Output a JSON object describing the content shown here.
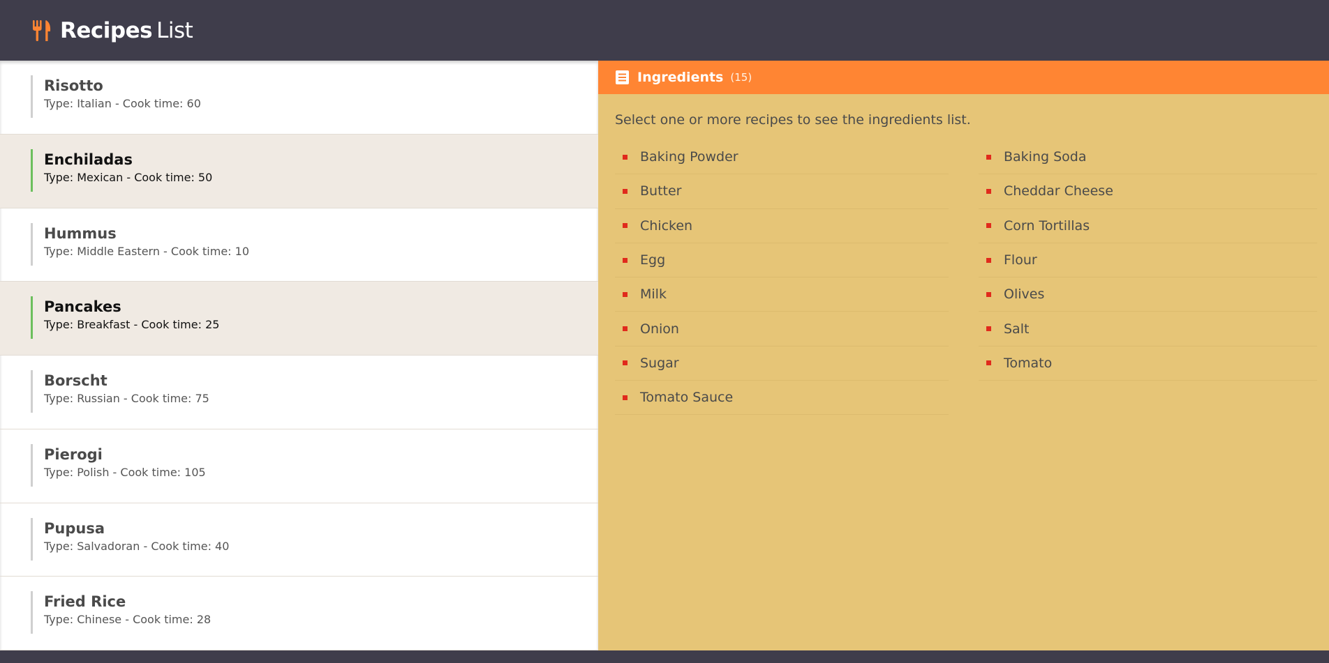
{
  "app": {
    "title_bold": "Recipes",
    "title_light": "List",
    "logo_icon": "fork-knife-icon"
  },
  "recipes": [
    {
      "name": "Risotto",
      "meta": "Type: Italian - Cook time: 60",
      "selected": false
    },
    {
      "name": "Enchiladas",
      "meta": "Type: Mexican - Cook time: 50",
      "selected": true
    },
    {
      "name": "Hummus",
      "meta": "Type: Middle Eastern - Cook time: 10",
      "selected": false
    },
    {
      "name": "Pancakes",
      "meta": "Type: Breakfast - Cook time: 25",
      "selected": true
    },
    {
      "name": "Borscht",
      "meta": "Type: Russian - Cook time: 75",
      "selected": false
    },
    {
      "name": "Pierogi",
      "meta": "Type: Polish - Cook time: 105",
      "selected": false
    },
    {
      "name": "Pupusa",
      "meta": "Type: Salvadoran - Cook time: 40",
      "selected": false
    },
    {
      "name": "Fried Rice",
      "meta": "Type: Chinese - Cook time: 28",
      "selected": false
    }
  ],
  "ingredients_panel": {
    "title": "Ingredients",
    "count": "(15)",
    "icon": "document-list-icon",
    "hint": "Select one or more recipes to see the ingredients list.",
    "column_left": [
      "Baking Powder",
      "Butter",
      "Chicken",
      "Egg",
      "Milk",
      "Onion",
      "Sugar",
      "Tomato Sauce"
    ],
    "column_right": [
      "Baking Soda",
      "Cheddar Cheese",
      "Corn Tortillas",
      "Flour",
      "Olives",
      "Salt",
      "Tomato"
    ]
  },
  "colors": {
    "header_bg": "#3f3d4b",
    "accent_orange": "#ff8533",
    "panel_bg": "#e6c577",
    "selected_bar": "#6cbf5d",
    "bullet_red": "#e02a1c"
  }
}
